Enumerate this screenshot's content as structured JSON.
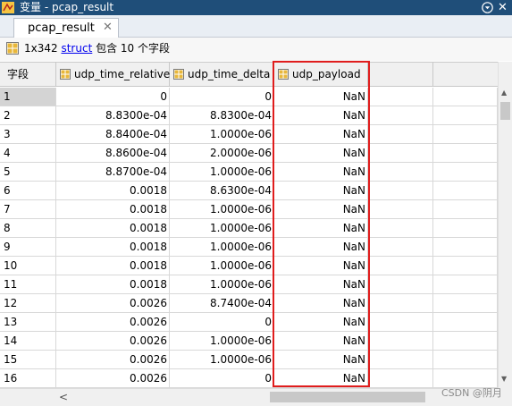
{
  "window": {
    "title": "变量 - pcap_result",
    "close_glyph": "✕",
    "menu_icon": "circle-chevron-down-icon"
  },
  "tab": {
    "label": "pcap_result",
    "close_glyph": "✕"
  },
  "infobar": {
    "size": "1x342",
    "type_link": "struct",
    "summary": "包含 10 个字段",
    "icon": "struct-icon"
  },
  "table": {
    "headers": [
      "字段",
      "udp_time_relative",
      "udp_time_delta",
      "udp_payload"
    ],
    "header_icon": "struct-field-icon",
    "rows": [
      [
        "1",
        "0",
        "0",
        "NaN"
      ],
      [
        "2",
        "8.8300e-04",
        "8.8300e-04",
        "NaN"
      ],
      [
        "3",
        "8.8400e-04",
        "1.0000e-06",
        "NaN"
      ],
      [
        "4",
        "8.8600e-04",
        "2.0000e-06",
        "NaN"
      ],
      [
        "5",
        "8.8700e-04",
        "1.0000e-06",
        "NaN"
      ],
      [
        "6",
        "0.0018",
        "8.6300e-04",
        "NaN"
      ],
      [
        "7",
        "0.0018",
        "1.0000e-06",
        "NaN"
      ],
      [
        "8",
        "0.0018",
        "1.0000e-06",
        "NaN"
      ],
      [
        "9",
        "0.0018",
        "1.0000e-06",
        "NaN"
      ],
      [
        "10",
        "0.0018",
        "1.0000e-06",
        "NaN"
      ],
      [
        "11",
        "0.0018",
        "1.0000e-06",
        "NaN"
      ],
      [
        "12",
        "0.0026",
        "8.7400e-04",
        "NaN"
      ],
      [
        "13",
        "0.0026",
        "0",
        "NaN"
      ],
      [
        "14",
        "0.0026",
        "1.0000e-06",
        "NaN"
      ],
      [
        "15",
        "0.0026",
        "1.0000e-06",
        "NaN"
      ],
      [
        "16",
        "0.0026",
        "0",
        "NaN"
      ]
    ],
    "selected_row": "1"
  },
  "scrollbars": {
    "up_glyph": "▲",
    "down_glyph": "▼",
    "left_glyph": "<"
  },
  "watermark": "CSDN @阴月",
  "colors": {
    "titlebar": "#1f4e79",
    "highlight": "#e01d1d",
    "link": "#0000ee"
  }
}
